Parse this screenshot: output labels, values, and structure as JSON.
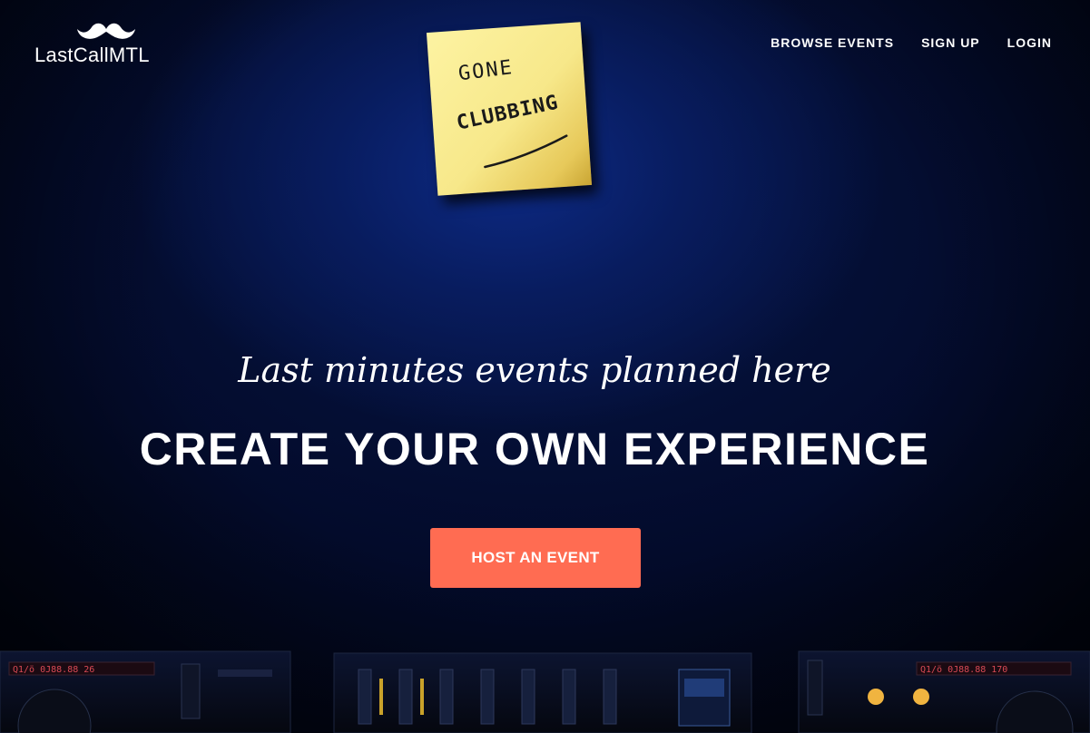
{
  "brand": {
    "name": "LastCallMTL",
    "logo_icon": "mustache-icon"
  },
  "nav": {
    "items": [
      {
        "label": "BROWSE EVENTS"
      },
      {
        "label": "SIGN UP"
      },
      {
        "label": "LOGIN"
      }
    ]
  },
  "hero": {
    "note": {
      "line1": "GONE",
      "line2": "CLUBBING"
    },
    "tagline": "Last minutes events planned here",
    "headline": "CREATE YOUR OWN EXPERIENCE",
    "cta_label": "HOST AN EVENT",
    "background": "dj-decks-photo"
  },
  "colors": {
    "accent": "#ff6c52",
    "background": "#06154a",
    "text": "#ffffff",
    "note_yellow": "#f7e88a"
  }
}
